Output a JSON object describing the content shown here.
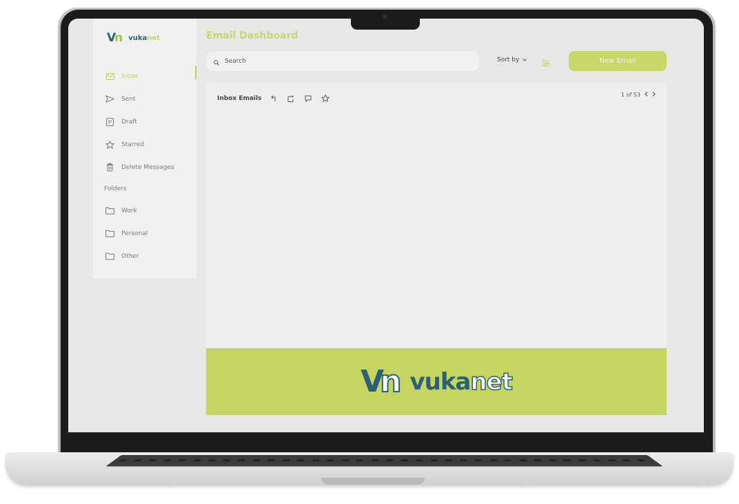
{
  "brand": {
    "name_part1": "vuka",
    "name_part2": "net"
  },
  "page_title": "Email Dashboard",
  "search": {
    "placeholder": "Search"
  },
  "sort": {
    "label": "Sort by"
  },
  "new_email_label": "New Email",
  "sidebar": {
    "items": [
      {
        "label": "Inbox",
        "icon": "mail-icon",
        "active": true
      },
      {
        "label": "Sent",
        "icon": "send-icon",
        "active": false
      },
      {
        "label": "Draft",
        "icon": "draft-icon",
        "active": false
      },
      {
        "label": "Starred",
        "icon": "star-icon",
        "active": false
      },
      {
        "label": "Delete Messages",
        "icon": "trash-icon",
        "active": false
      }
    ],
    "folders_heading": "Folders",
    "folders": [
      {
        "label": "Work",
        "icon": "folder-icon"
      },
      {
        "label": "Personal",
        "icon": "folder-icon"
      },
      {
        "label": "Other",
        "icon": "folder-icon"
      }
    ]
  },
  "panel": {
    "title": "Inbox Emails",
    "toolbar_icons": [
      "reply-icon",
      "forward-icon",
      "comment-icon",
      "star-icon"
    ],
    "pager": "1 of 53"
  },
  "colors": {
    "accent": "#c6d462",
    "brand_dark": "#2b6173",
    "screen_bg": "#e7e7e6"
  }
}
